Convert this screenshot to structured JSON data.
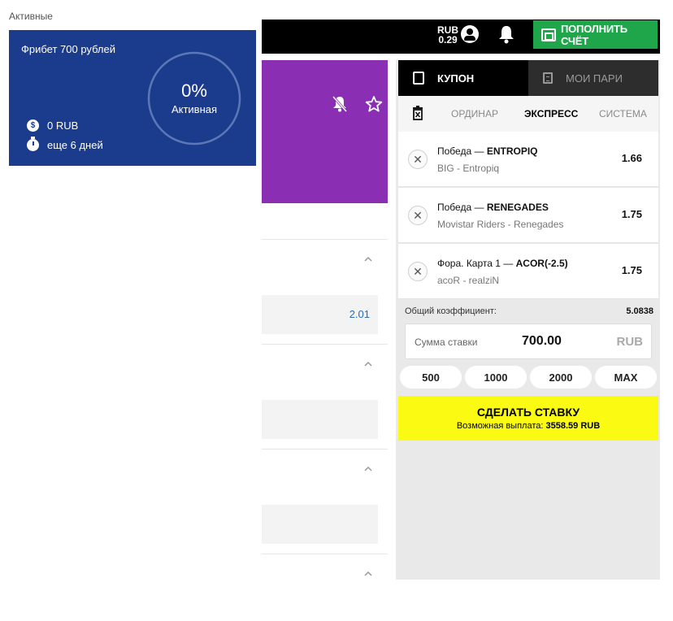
{
  "section_label": "Активные",
  "header": {
    "currency": "RUB",
    "balance": "0.29",
    "deposit_label": "ПОПОЛНИТЬ СЧЁТ"
  },
  "freebet": {
    "title": "Фрибет 700 рублей",
    "amount": "0 RUB",
    "time_left": "еще 6 дней",
    "progress_percent": "0%",
    "status": "Активная"
  },
  "left_list": {
    "odd_value": "2.01"
  },
  "coupon": {
    "tab_coupon": "КУПОН",
    "tab_my_bets": "МОИ ПАРИ",
    "bet_types": [
      "ОРДИНАР",
      "ЭКСПРЕСС",
      "СИСТЕМА"
    ],
    "active_bet_type": "ЭКСПРЕСС",
    "bets": [
      {
        "market": "Победа —",
        "selection": "ENTROPIQ",
        "match": "BIG - Entropiq",
        "odd": "1.66"
      },
      {
        "market": "Победа —",
        "selection": "RENEGADES",
        "match": "Movistar Riders - Renegades",
        "odd": "1.75"
      },
      {
        "market": "Фора. Карта 1 —",
        "selection": "ACOR(-2.5)",
        "match": "acoR - realziN",
        "odd": "1.75"
      }
    ],
    "total_odds_label": "Общий коэффициент:",
    "total_odds_value": "5.0838",
    "stake_label": "Сумма ставки",
    "stake_value": "700.00",
    "stake_currency": "RUB",
    "quick_amounts": [
      "500",
      "1000",
      "2000",
      "MAX"
    ],
    "place_bet_label": "СДЕЛАТЬ СТАВКУ",
    "payout_label": "Возможная выплата:",
    "payout_value": "3558.59 RUB"
  },
  "colors": {
    "freebet_bg": "#1b3c8c",
    "deposit_bg": "#1fa64a",
    "event_banner": "#8a2fb3",
    "place_bet_bg": "#fafa12"
  }
}
